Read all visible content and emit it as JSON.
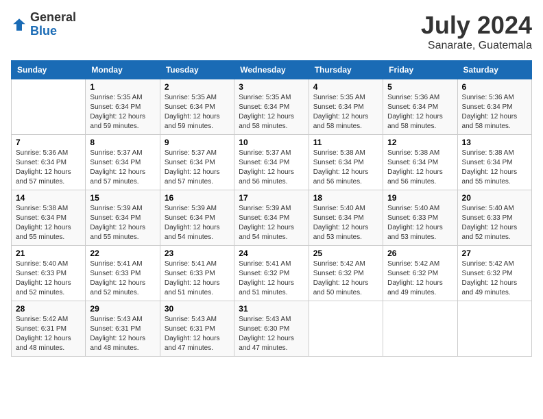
{
  "header": {
    "logo_general": "General",
    "logo_blue": "Blue",
    "month_title": "July 2024",
    "subtitle": "Sanarate, Guatemala"
  },
  "calendar": {
    "days_of_week": [
      "Sunday",
      "Monday",
      "Tuesday",
      "Wednesday",
      "Thursday",
      "Friday",
      "Saturday"
    ],
    "weeks": [
      [
        {
          "day": "",
          "info": ""
        },
        {
          "day": "1",
          "info": "Sunrise: 5:35 AM\nSunset: 6:34 PM\nDaylight: 12 hours\nand 59 minutes."
        },
        {
          "day": "2",
          "info": "Sunrise: 5:35 AM\nSunset: 6:34 PM\nDaylight: 12 hours\nand 59 minutes."
        },
        {
          "day": "3",
          "info": "Sunrise: 5:35 AM\nSunset: 6:34 PM\nDaylight: 12 hours\nand 58 minutes."
        },
        {
          "day": "4",
          "info": "Sunrise: 5:35 AM\nSunset: 6:34 PM\nDaylight: 12 hours\nand 58 minutes."
        },
        {
          "day": "5",
          "info": "Sunrise: 5:36 AM\nSunset: 6:34 PM\nDaylight: 12 hours\nand 58 minutes."
        },
        {
          "day": "6",
          "info": "Sunrise: 5:36 AM\nSunset: 6:34 PM\nDaylight: 12 hours\nand 58 minutes."
        }
      ],
      [
        {
          "day": "7",
          "info": "Sunrise: 5:36 AM\nSunset: 6:34 PM\nDaylight: 12 hours\nand 57 minutes."
        },
        {
          "day": "8",
          "info": "Sunrise: 5:37 AM\nSunset: 6:34 PM\nDaylight: 12 hours\nand 57 minutes."
        },
        {
          "day": "9",
          "info": "Sunrise: 5:37 AM\nSunset: 6:34 PM\nDaylight: 12 hours\nand 57 minutes."
        },
        {
          "day": "10",
          "info": "Sunrise: 5:37 AM\nSunset: 6:34 PM\nDaylight: 12 hours\nand 56 minutes."
        },
        {
          "day": "11",
          "info": "Sunrise: 5:38 AM\nSunset: 6:34 PM\nDaylight: 12 hours\nand 56 minutes."
        },
        {
          "day": "12",
          "info": "Sunrise: 5:38 AM\nSunset: 6:34 PM\nDaylight: 12 hours\nand 56 minutes."
        },
        {
          "day": "13",
          "info": "Sunrise: 5:38 AM\nSunset: 6:34 PM\nDaylight: 12 hours\nand 55 minutes."
        }
      ],
      [
        {
          "day": "14",
          "info": "Sunrise: 5:38 AM\nSunset: 6:34 PM\nDaylight: 12 hours\nand 55 minutes."
        },
        {
          "day": "15",
          "info": "Sunrise: 5:39 AM\nSunset: 6:34 PM\nDaylight: 12 hours\nand 55 minutes."
        },
        {
          "day": "16",
          "info": "Sunrise: 5:39 AM\nSunset: 6:34 PM\nDaylight: 12 hours\nand 54 minutes."
        },
        {
          "day": "17",
          "info": "Sunrise: 5:39 AM\nSunset: 6:34 PM\nDaylight: 12 hours\nand 54 minutes."
        },
        {
          "day": "18",
          "info": "Sunrise: 5:40 AM\nSunset: 6:34 PM\nDaylight: 12 hours\nand 53 minutes."
        },
        {
          "day": "19",
          "info": "Sunrise: 5:40 AM\nSunset: 6:33 PM\nDaylight: 12 hours\nand 53 minutes."
        },
        {
          "day": "20",
          "info": "Sunrise: 5:40 AM\nSunset: 6:33 PM\nDaylight: 12 hours\nand 52 minutes."
        }
      ],
      [
        {
          "day": "21",
          "info": "Sunrise: 5:40 AM\nSunset: 6:33 PM\nDaylight: 12 hours\nand 52 minutes."
        },
        {
          "day": "22",
          "info": "Sunrise: 5:41 AM\nSunset: 6:33 PM\nDaylight: 12 hours\nand 52 minutes."
        },
        {
          "day": "23",
          "info": "Sunrise: 5:41 AM\nSunset: 6:33 PM\nDaylight: 12 hours\nand 51 minutes."
        },
        {
          "day": "24",
          "info": "Sunrise: 5:41 AM\nSunset: 6:32 PM\nDaylight: 12 hours\nand 51 minutes."
        },
        {
          "day": "25",
          "info": "Sunrise: 5:42 AM\nSunset: 6:32 PM\nDaylight: 12 hours\nand 50 minutes."
        },
        {
          "day": "26",
          "info": "Sunrise: 5:42 AM\nSunset: 6:32 PM\nDaylight: 12 hours\nand 49 minutes."
        },
        {
          "day": "27",
          "info": "Sunrise: 5:42 AM\nSunset: 6:32 PM\nDaylight: 12 hours\nand 49 minutes."
        }
      ],
      [
        {
          "day": "28",
          "info": "Sunrise: 5:42 AM\nSunset: 6:31 PM\nDaylight: 12 hours\nand 48 minutes."
        },
        {
          "day": "29",
          "info": "Sunrise: 5:43 AM\nSunset: 6:31 PM\nDaylight: 12 hours\nand 48 minutes."
        },
        {
          "day": "30",
          "info": "Sunrise: 5:43 AM\nSunset: 6:31 PM\nDaylight: 12 hours\nand 47 minutes."
        },
        {
          "day": "31",
          "info": "Sunrise: 5:43 AM\nSunset: 6:30 PM\nDaylight: 12 hours\nand 47 minutes."
        },
        {
          "day": "",
          "info": ""
        },
        {
          "day": "",
          "info": ""
        },
        {
          "day": "",
          "info": ""
        }
      ]
    ]
  }
}
